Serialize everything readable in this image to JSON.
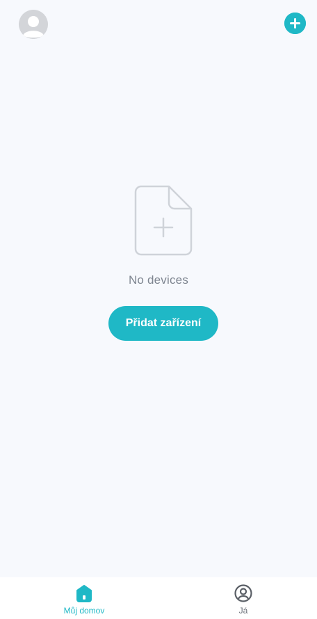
{
  "header": {
    "avatar_icon": "user-avatar-icon",
    "add_icon": "plus-circle-icon"
  },
  "empty_state": {
    "illustration_icon": "new-document-icon",
    "message": "No devices",
    "button_label": "Přidat zařízení"
  },
  "bottom_nav": {
    "items": [
      {
        "label": "Můj domov",
        "icon": "home-icon",
        "active": true
      },
      {
        "label": "Já",
        "icon": "profile-icon",
        "active": false
      }
    ]
  },
  "colors": {
    "accent": "#1fb8c6",
    "background": "#f7f9fd",
    "muted_text": "#7e8590",
    "inactive_nav": "#6b7078"
  }
}
